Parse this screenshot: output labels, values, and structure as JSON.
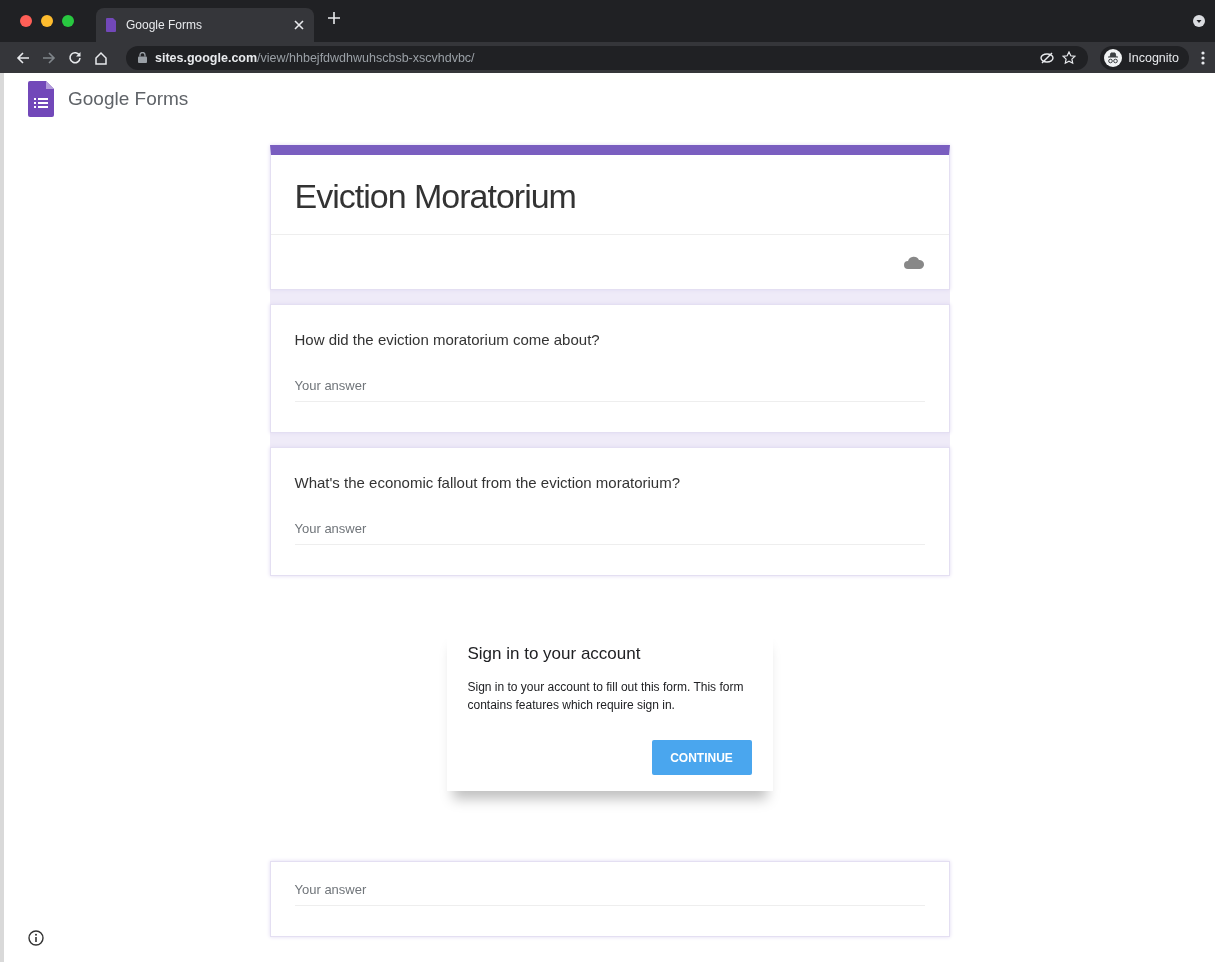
{
  "browser": {
    "tabs": [
      {
        "title": "Google Forms",
        "selected": true
      }
    ],
    "url_host": "sites.google.com",
    "url_path": "/view/hhbejfdwdhwuhscbsb-xscvhdvbc/",
    "profile": "Incognito"
  },
  "app_header": {
    "name": "Google Forms"
  },
  "form": {
    "title": "Eviction Moratorium",
    "questions": [
      {
        "text": "How did the eviction moratorium come about?",
        "placeholder": "Your answer"
      },
      {
        "text": "What's the economic fallout from the eviction moratorium?",
        "placeholder": "Your answer"
      }
    ],
    "lower_placeholder": "Your answer"
  },
  "dialog": {
    "title": "Sign in to your account",
    "message": "Sign in to your account to fill out this form. This form contains features which require sign in.",
    "button": "CONTINUE"
  }
}
